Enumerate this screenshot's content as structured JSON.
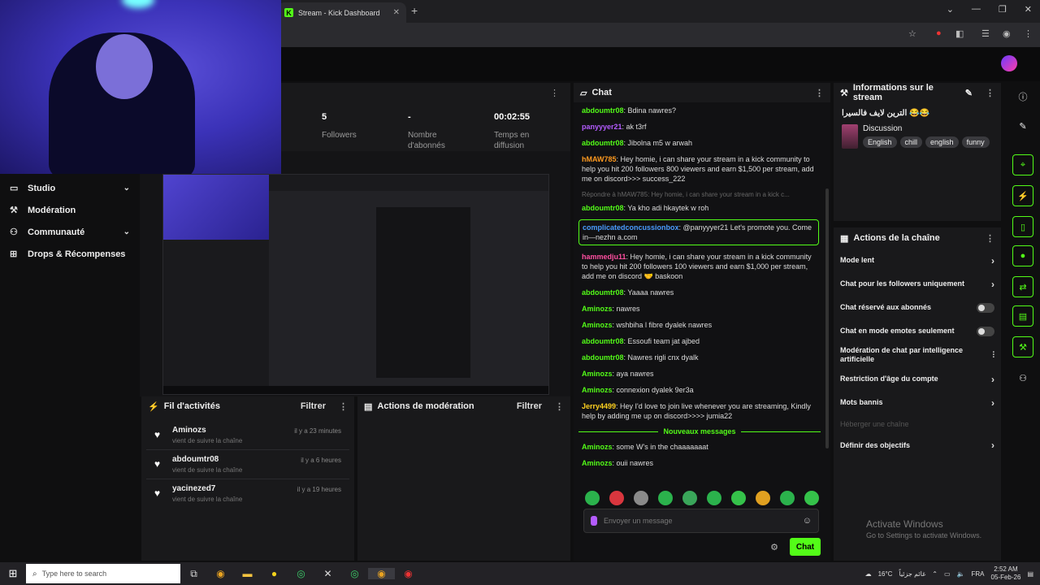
{
  "browser": {
    "tab_title": "Stream - Kick Dashboard"
  },
  "sidebar": {
    "items": [
      {
        "label": "Studio",
        "has_chevron": true
      },
      {
        "label": "Modération",
        "has_chevron": false
      },
      {
        "label": "Communauté",
        "has_chevron": true
      },
      {
        "label": "Drops & Récompenses",
        "has_chevron": false
      }
    ]
  },
  "stats": {
    "followers_value": "5",
    "followers_label": "Followers",
    "subs_value": "-",
    "subs_label": "Nombre d'abonnés",
    "uptime_value": "00:02:55",
    "uptime_label": "Temps en diffusion"
  },
  "activity": {
    "title": "Fil d'activités",
    "filter": "Filtrer",
    "items": [
      {
        "name": "Aminozs",
        "sub": "vient de suivre la chaîne",
        "time": "il y a 23 minutes"
      },
      {
        "name": "abdoumtr08",
        "sub": "vient de suivre la chaîne",
        "time": "il y a 6 heures"
      },
      {
        "name": "yacinezed7",
        "sub": "vient de suivre la chaîne",
        "time": "il y a 19 heures"
      }
    ]
  },
  "moderation": {
    "title": "Actions de modération",
    "filter": "Filtrer"
  },
  "chat": {
    "title": "Chat",
    "messages": [
      {
        "user": "abdoumtr08",
        "color": "#53fc18",
        "text": ": Bdina nawres?"
      },
      {
        "user": "panyyyer21",
        "color": "#b45cff",
        "text": ": ak t3rf"
      },
      {
        "user": "abdoumtr08",
        "color": "#53fc18",
        "text": ": Jibolna m5 w arwah"
      },
      {
        "user": "hMAW785",
        "color": "#ff9a1f",
        "text": ": Hey homie, i can share your stream in a kick community to help you hit 200 followers 800 viewers and earn $1,500 per stream, add me on discord>>> success_222"
      },
      {
        "reply": "Répondre à hMAW785: Hey homie, i can share your stream in a kick c..."
      },
      {
        "user": "abdoumtr08",
        "color": "#53fc18",
        "text": ": Ya kho adi hkaytek w roh"
      },
      {
        "user": "complicatedconcussionbox",
        "color": "#4a9cff",
        "text": ": @panyyyer21 Let's promote you. Come in—nezhn a.com",
        "highlight": true
      },
      {
        "user": "hammedju11",
        "color": "#ff4fa0",
        "text": ": Hey homie, i can share your stream in a kick community to help you hit 200 followers 100 viewers and earn $1,000 per stream, add me on discord 🤝 baskoon"
      },
      {
        "user": "abdoumtr08",
        "color": "#53fc18",
        "text": ": Yaaaa nawres"
      },
      {
        "user": "Aminozs",
        "color": "#53fc18",
        "text": ": nawres"
      },
      {
        "user": "Aminozs",
        "color": "#53fc18",
        "text": ": wshbiha l fibre dyalek nawres"
      },
      {
        "user": "abdoumtr08",
        "color": "#53fc18",
        "text": ": Essoufi team jat ajbed"
      },
      {
        "user": "abdoumtr08",
        "color": "#53fc18",
        "text": ": Nawres rigli cnx dyalk"
      },
      {
        "user": "Aminozs",
        "color": "#53fc18",
        "text": ": aya nawres"
      },
      {
        "user": "Aminozs",
        "color": "#53fc18",
        "text": ": connexion dyalek 9er3a"
      },
      {
        "user": "Jerry4499",
        "color": "#ffd21f",
        "text": ": Hey I'd love to join live whenever you are streaming, Kindly help by adding me up on discord>>>> jumia22"
      },
      {
        "separator": "Nouveaux messages"
      },
      {
        "user": "Aminozs",
        "color": "#53fc18",
        "text": ": some W's in the chaaaaaaat"
      },
      {
        "user": "Aminozs",
        "color": "#53fc18",
        "text": ": ouii nawres"
      }
    ],
    "input_placeholder": "Envoyer un message",
    "send_label": "Chat"
  },
  "stream_info": {
    "title": "Informations sur le stream",
    "stream_title": "الترين لايف فالسيرا 😂😂",
    "category": "Discussion",
    "tags": [
      "English",
      "chill",
      "english",
      "funny"
    ]
  },
  "channel_actions": {
    "title": "Actions de la chaîne",
    "rows": [
      {
        "label": "Mode lent",
        "control": "chevron"
      },
      {
        "label": "Chat pour les followers uniquement",
        "control": "chevron"
      },
      {
        "label": "Chat réservé aux abonnés",
        "control": "toggle"
      },
      {
        "label": "Chat en mode emotes seulement",
        "control": "toggle"
      },
      {
        "label": "Modération de chat par intelligence artificielle",
        "control": "icon"
      },
      {
        "label": "Restriction d'âge du compte",
        "control": "chevron"
      },
      {
        "label": "Mots bannis",
        "control": "chevron"
      },
      {
        "label": "Héberger une chaîne",
        "control": "none",
        "dim": true
      },
      {
        "label": "Définir des objectifs",
        "control": "chevron"
      }
    ]
  },
  "watermark": {
    "line1": "Activate Windows",
    "line2": "Go to Settings to activate Windows."
  },
  "taskbar": {
    "search_placeholder": "Type here to search",
    "temp": "16°C",
    "weather": "غائم جزئياً",
    "lang": "FRA",
    "time": "2:52 AM",
    "date": "05-Feb-26"
  }
}
